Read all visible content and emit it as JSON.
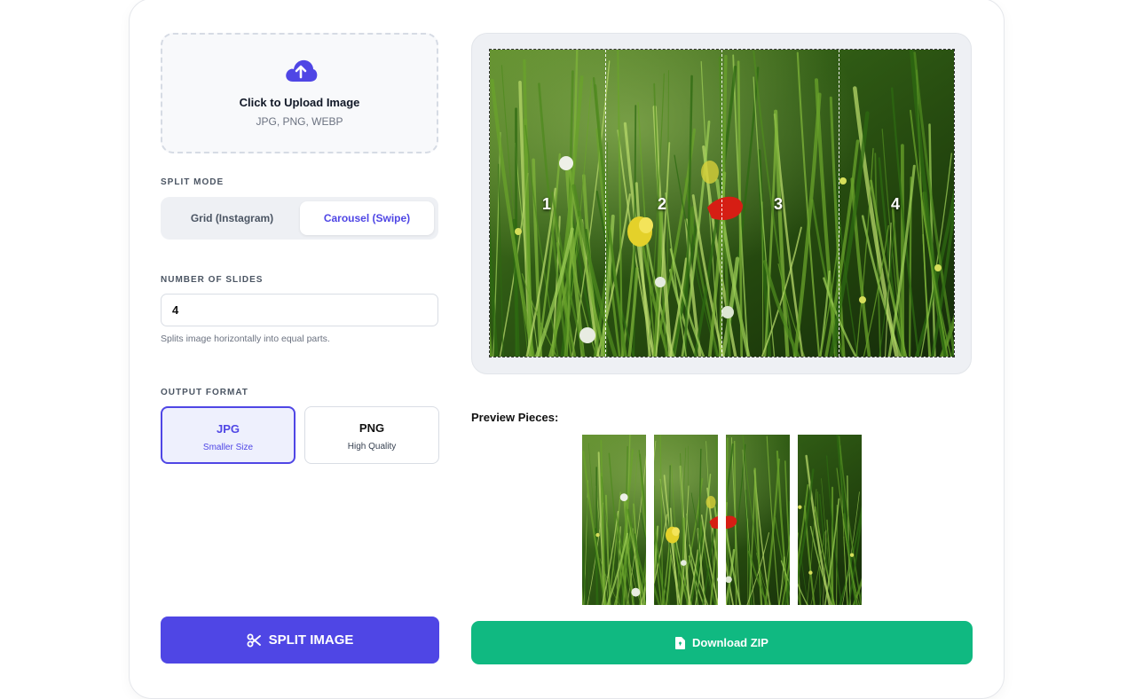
{
  "upload": {
    "icon": "cloud-upload-icon",
    "title": "Click to Upload Image",
    "formats": "JPG, PNG, WEBP"
  },
  "split_mode": {
    "label": "SPLIT MODE",
    "options": [
      "Grid (Instagram)",
      "Carousel (Swipe)"
    ],
    "selected": "Carousel (Swipe)"
  },
  "slides": {
    "label": "NUMBER OF SLIDES",
    "value": "4",
    "hint": "Splits image horizontally into equal parts."
  },
  "output_format": {
    "label": "OUTPUT FORMAT",
    "options": [
      {
        "title": "JPG",
        "subtitle": "Smaller Size"
      },
      {
        "title": "PNG",
        "subtitle": "High Quality"
      }
    ],
    "selected": "JPG"
  },
  "split_button": {
    "label": "SPLIT IMAGE",
    "icon": "scissors-icon"
  },
  "preview": {
    "slice_numbers": [
      "1",
      "2",
      "3",
      "4"
    ]
  },
  "preview_pieces": {
    "label": "Preview Pieces:"
  },
  "download_button": {
    "label": "Download ZIP",
    "icon": "file-zip-icon"
  },
  "colors": {
    "accent": "#4f46e5",
    "download": "#10b981",
    "segment_bg": "#eef0f4"
  }
}
